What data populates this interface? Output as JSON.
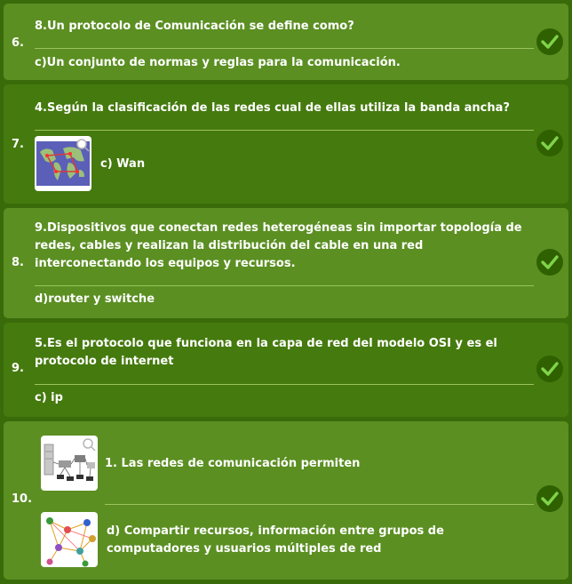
{
  "questions": [
    {
      "number": "6.",
      "question": "8.Un protocolo de Comunicación se define como?",
      "answer": "c)Un conjunto de normas y reglas para la comunicación.",
      "status_icon": "check-icon"
    },
    {
      "number": "7.",
      "question": "4.Según la clasificación de las redes cual de ellas utiliza la banda ancha?",
      "answer": "c) Wan",
      "answer_image": "world-map-network-image",
      "status_icon": "check-icon"
    },
    {
      "number": "8.",
      "question": "9.Dispositivos que conectan redes heterogéneas sin importar topología de redes, cables y realizan la distribución del cable en una red interconectando los equipos y recursos.",
      "answer": "d)router y switche",
      "status_icon": "check-icon"
    },
    {
      "number": "9.",
      "question": "5.Es el protocolo que funciona en la capa de red del modelo OSI y es el protocolo de internet",
      "answer": "c) ip",
      "status_icon": "check-icon"
    },
    {
      "number": "10.",
      "question": "1. Las redes de comunicación permiten",
      "question_image": "network-devices-image",
      "answer": "d) Compartir recursos, información entre grupos de computadores y usuarios múltiples de red",
      "answer_image": "people-network-image",
      "status_icon": "check-icon"
    }
  ],
  "colors": {
    "background": "#3a6b0a",
    "card_light": "#5b8f22",
    "card_dark": "#457a0e",
    "check": "#7fd34a",
    "check_bg": "#2f6100"
  }
}
